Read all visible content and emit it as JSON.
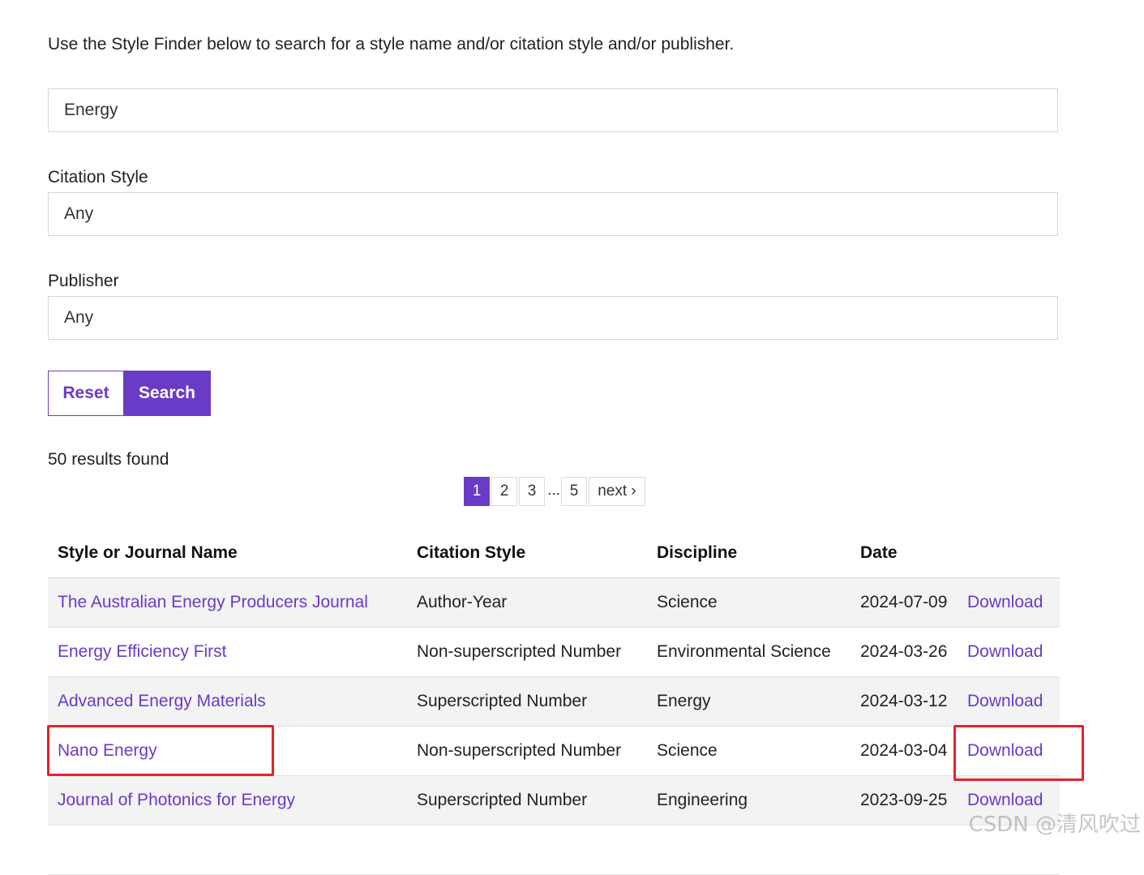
{
  "intro_text": "Use the Style Finder below to search for a style name and/or citation style and/or publisher.",
  "search": {
    "value": "Energy"
  },
  "citation_style": {
    "label": "Citation Style",
    "value": "Any"
  },
  "publisher": {
    "label": "Publisher",
    "value": "Any"
  },
  "buttons": {
    "reset": "Reset",
    "search": "Search"
  },
  "results_count": "50 results found",
  "pagination": {
    "pages": [
      "1",
      "2",
      "3",
      "5"
    ],
    "ellipsis": "...",
    "next": "next ›",
    "current": "1"
  },
  "table": {
    "headers": [
      "Style or Journal Name",
      "Citation Style",
      "Discipline",
      "Date"
    ],
    "rows": [
      {
        "name": "The Australian Energy Producers Journal",
        "citation": "Author-Year",
        "discipline": "Science",
        "date": "2024-07-09",
        "action": "Download"
      },
      {
        "name": "Energy Efficiency First",
        "citation": "Non-superscripted Number",
        "discipline": "Environmental Science",
        "date": "2024-03-26",
        "action": "Download"
      },
      {
        "name": "Advanced Energy Materials",
        "citation": "Superscripted Number",
        "discipline": "Energy",
        "date": "2024-03-12",
        "action": "Download"
      },
      {
        "name": "Nano Energy",
        "citation": "Non-superscripted Number",
        "discipline": "Science",
        "date": "2024-03-04",
        "action": "Download"
      },
      {
        "name": "Journal of Photonics for Energy",
        "citation": "Superscripted Number",
        "discipline": "Engineering",
        "date": "2023-09-25",
        "action": "Download"
      }
    ]
  },
  "colors": {
    "accent": "#6a3bc6",
    "highlight": "#e8202a"
  },
  "watermark": "CSDN @清风吹过"
}
